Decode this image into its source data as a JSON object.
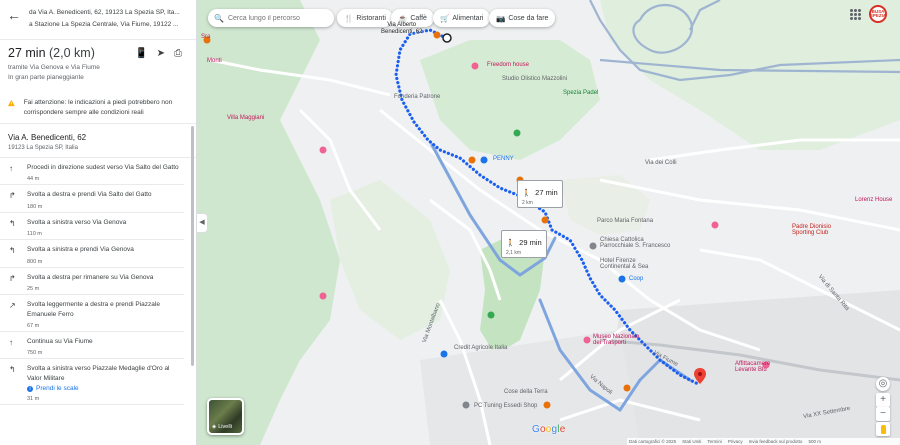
{
  "route_header": {
    "from": "da Via A. Benedicenti, 62, 19123 La Spezia SP, Ita...",
    "to": "a Stazione La Spezia Centrale, Via Fiume, 19122 ..."
  },
  "summary": {
    "duration": "27 min",
    "distance": "(2,0 km)",
    "via": "tramite Via Genova e Via Fiume",
    "terrain": "In gran parte pianeggiante",
    "icons": [
      "send-to-phone-icon",
      "share-icon",
      "print-icon"
    ]
  },
  "warning": "Fai attenzione: le indicazioni a piedi potrebbero non corrispondere sempre alle condizioni reali",
  "origin": {
    "title": "Via A. Benedicenti, 62",
    "subtitle": "19123 La Spezia SP, Italia"
  },
  "steps": [
    {
      "icon": "↑",
      "text": "Procedi in direzione sudest verso Via Salto del Gatto",
      "dist": "44 m"
    },
    {
      "icon": "↱",
      "text": "Svolta a destra e prendi Via Salto del Gatto",
      "dist": "180 m"
    },
    {
      "icon": "↰",
      "text": "Svolta a sinistra verso Via Genova",
      "dist": "110 m"
    },
    {
      "icon": "↰",
      "text": "Svolta a sinistra e prendi Via Genova",
      "dist": "800 m"
    },
    {
      "icon": "↱",
      "text": "Svolta a destra per rimanere su Via Genova",
      "dist": "25 m"
    },
    {
      "icon": "↗",
      "text": "Svolta leggermente a destra e prendi Piazzale Emanuele Ferro",
      "dist": "67 m"
    },
    {
      "icon": "↑",
      "text": "Continua su Via Fiume",
      "dist": "750 m"
    },
    {
      "icon": "↰",
      "text": "Svolta a sinistra verso Piazzale Medaglie d'Oro al Valor Militare",
      "dist": "31 m"
    }
  ],
  "stairs_link": "Prendi le scale",
  "search": {
    "placeholder": "Cerca lungo il percorso"
  },
  "chips": [
    {
      "icon": "🍴",
      "label": "Ristoranti"
    },
    {
      "icon": "☕",
      "label": "Caffè"
    },
    {
      "icon": "🛒",
      "label": "Alimentari"
    },
    {
      "icon": "📷",
      "label": "Cose da fare"
    }
  ],
  "avatar_text": "BUSA\nSPEZIA",
  "map_labels": {
    "origin_pin": "Via Alberto\nBenedicenti, 62",
    "alt_route_1": {
      "time": "27 min",
      "dist": "2 km"
    },
    "alt_route_2": {
      "time": "29 min",
      "dist": "2,1 km"
    },
    "places": [
      {
        "text": "Sra",
        "cls": "lbl-pink"
      },
      {
        "text": "Monti",
        "cls": "lbl-pink"
      },
      {
        "text": "Villa Maggiani",
        "cls": "lbl-pink"
      },
      {
        "text": "Fonderia Patrone",
        "cls": "lbl-gray"
      },
      {
        "text": "Freedom house",
        "cls": "lbl-pink"
      },
      {
        "text": "Studio Olistico Mazzolini",
        "cls": "lbl-gray"
      },
      {
        "text": "Spezia Padel",
        "cls": "lbl-green"
      },
      {
        "text": "PENNY",
        "cls": "lbl-blue"
      },
      {
        "text": "Via dei Colli",
        "cls": "lbl-gray"
      },
      {
        "text": "Lorenz House",
        "cls": "lbl-pink"
      },
      {
        "text": "Parco Maria Fontana",
        "cls": "lbl-gray"
      },
      {
        "text": "Chiesa Cattolica\nParrocchiale S. Francesco",
        "cls": "lbl-gray"
      },
      {
        "text": "Hotel Firenze\nContinental & Sea",
        "cls": "lbl-gray"
      },
      {
        "text": "Coop",
        "cls": "lbl-blue"
      },
      {
        "text": "Padre Dionisio\nSporting Club",
        "cls": "lbl-red"
      },
      {
        "text": "Museo Nazionale\ndei Trasporti",
        "cls": "lbl-pink"
      },
      {
        "text": "Credit Agricole Italia",
        "cls": "lbl-gray"
      },
      {
        "text": "Cose della Terra",
        "cls": "lbl-gray"
      },
      {
        "text": "PC Tuning Essedi Shop",
        "cls": "lbl-gray"
      },
      {
        "text": "Affittacamere\nLevante Blu",
        "cls": "lbl-pink"
      },
      {
        "text": "Via Fiume",
        "cls": "lbl-gray"
      },
      {
        "text": "Via Napoli",
        "cls": "lbl-gray"
      },
      {
        "text": "Via Montalbano",
        "cls": "lbl-gray"
      },
      {
        "text": "Via XX Settembre",
        "cls": "lbl-gray"
      },
      {
        "text": "Via di Santa Rita",
        "cls": "lbl-gray"
      }
    ]
  },
  "layers_label": "Livelli",
  "zoom": {
    "in": "+",
    "out": "−"
  },
  "google": "Google",
  "footer": [
    "Dati cartografici © 2025",
    "Stati Uniti",
    "Termini",
    "Privacy",
    "Invia feedback sul prodotto",
    "500 m"
  ]
}
